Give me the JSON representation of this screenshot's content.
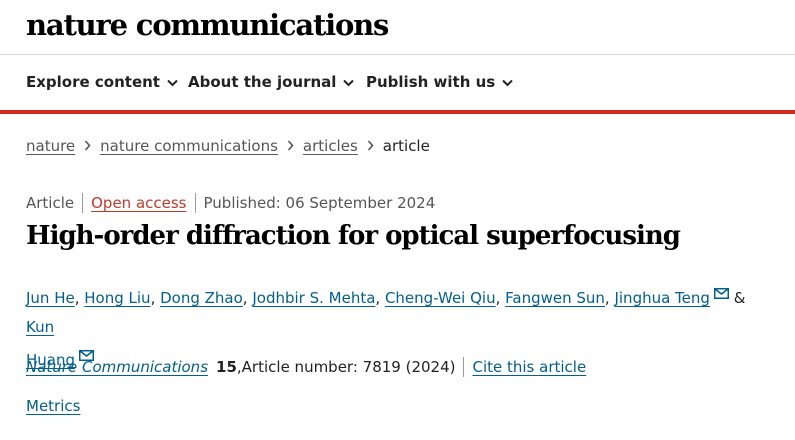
{
  "brand": {
    "logo_text": "nature communications"
  },
  "nav": {
    "items": [
      {
        "label": "Explore content"
      },
      {
        "label": "About the journal"
      },
      {
        "label": "Publish with us"
      }
    ]
  },
  "breadcrumb": {
    "items": [
      "nature",
      "nature communications",
      "articles"
    ],
    "current": "article"
  },
  "meta": {
    "type": "Article",
    "access": "Open access",
    "published": "Published: 06 September 2024"
  },
  "article": {
    "title": "High-order diffraction for optical superfocusing"
  },
  "authors": {
    "list": [
      "Jun He",
      "Hong Liu",
      "Dong Zhao",
      "Jodhbir S. Mehta",
      "Cheng-Wei Qiu",
      "Fangwen Sun",
      "Jinghua Teng"
    ],
    "separator": ", ",
    "conjunction": "&",
    "last_first": "Kun",
    "last_second": "Huang"
  },
  "citation": {
    "journal": "Nature Communications",
    "volume": "15",
    "details": "Article number: 7819 (2024)",
    "cite_label": "Cite this article"
  },
  "metrics": {
    "label": "Metrics"
  },
  "icons": {
    "chevron": "chevron-down-icon",
    "crumb_sep": "chevron-right-icon",
    "mail": "mail-icon"
  },
  "colors": {
    "accent": "#d22e1e",
    "link": "#025e8d",
    "open_access": "#c0392b"
  }
}
